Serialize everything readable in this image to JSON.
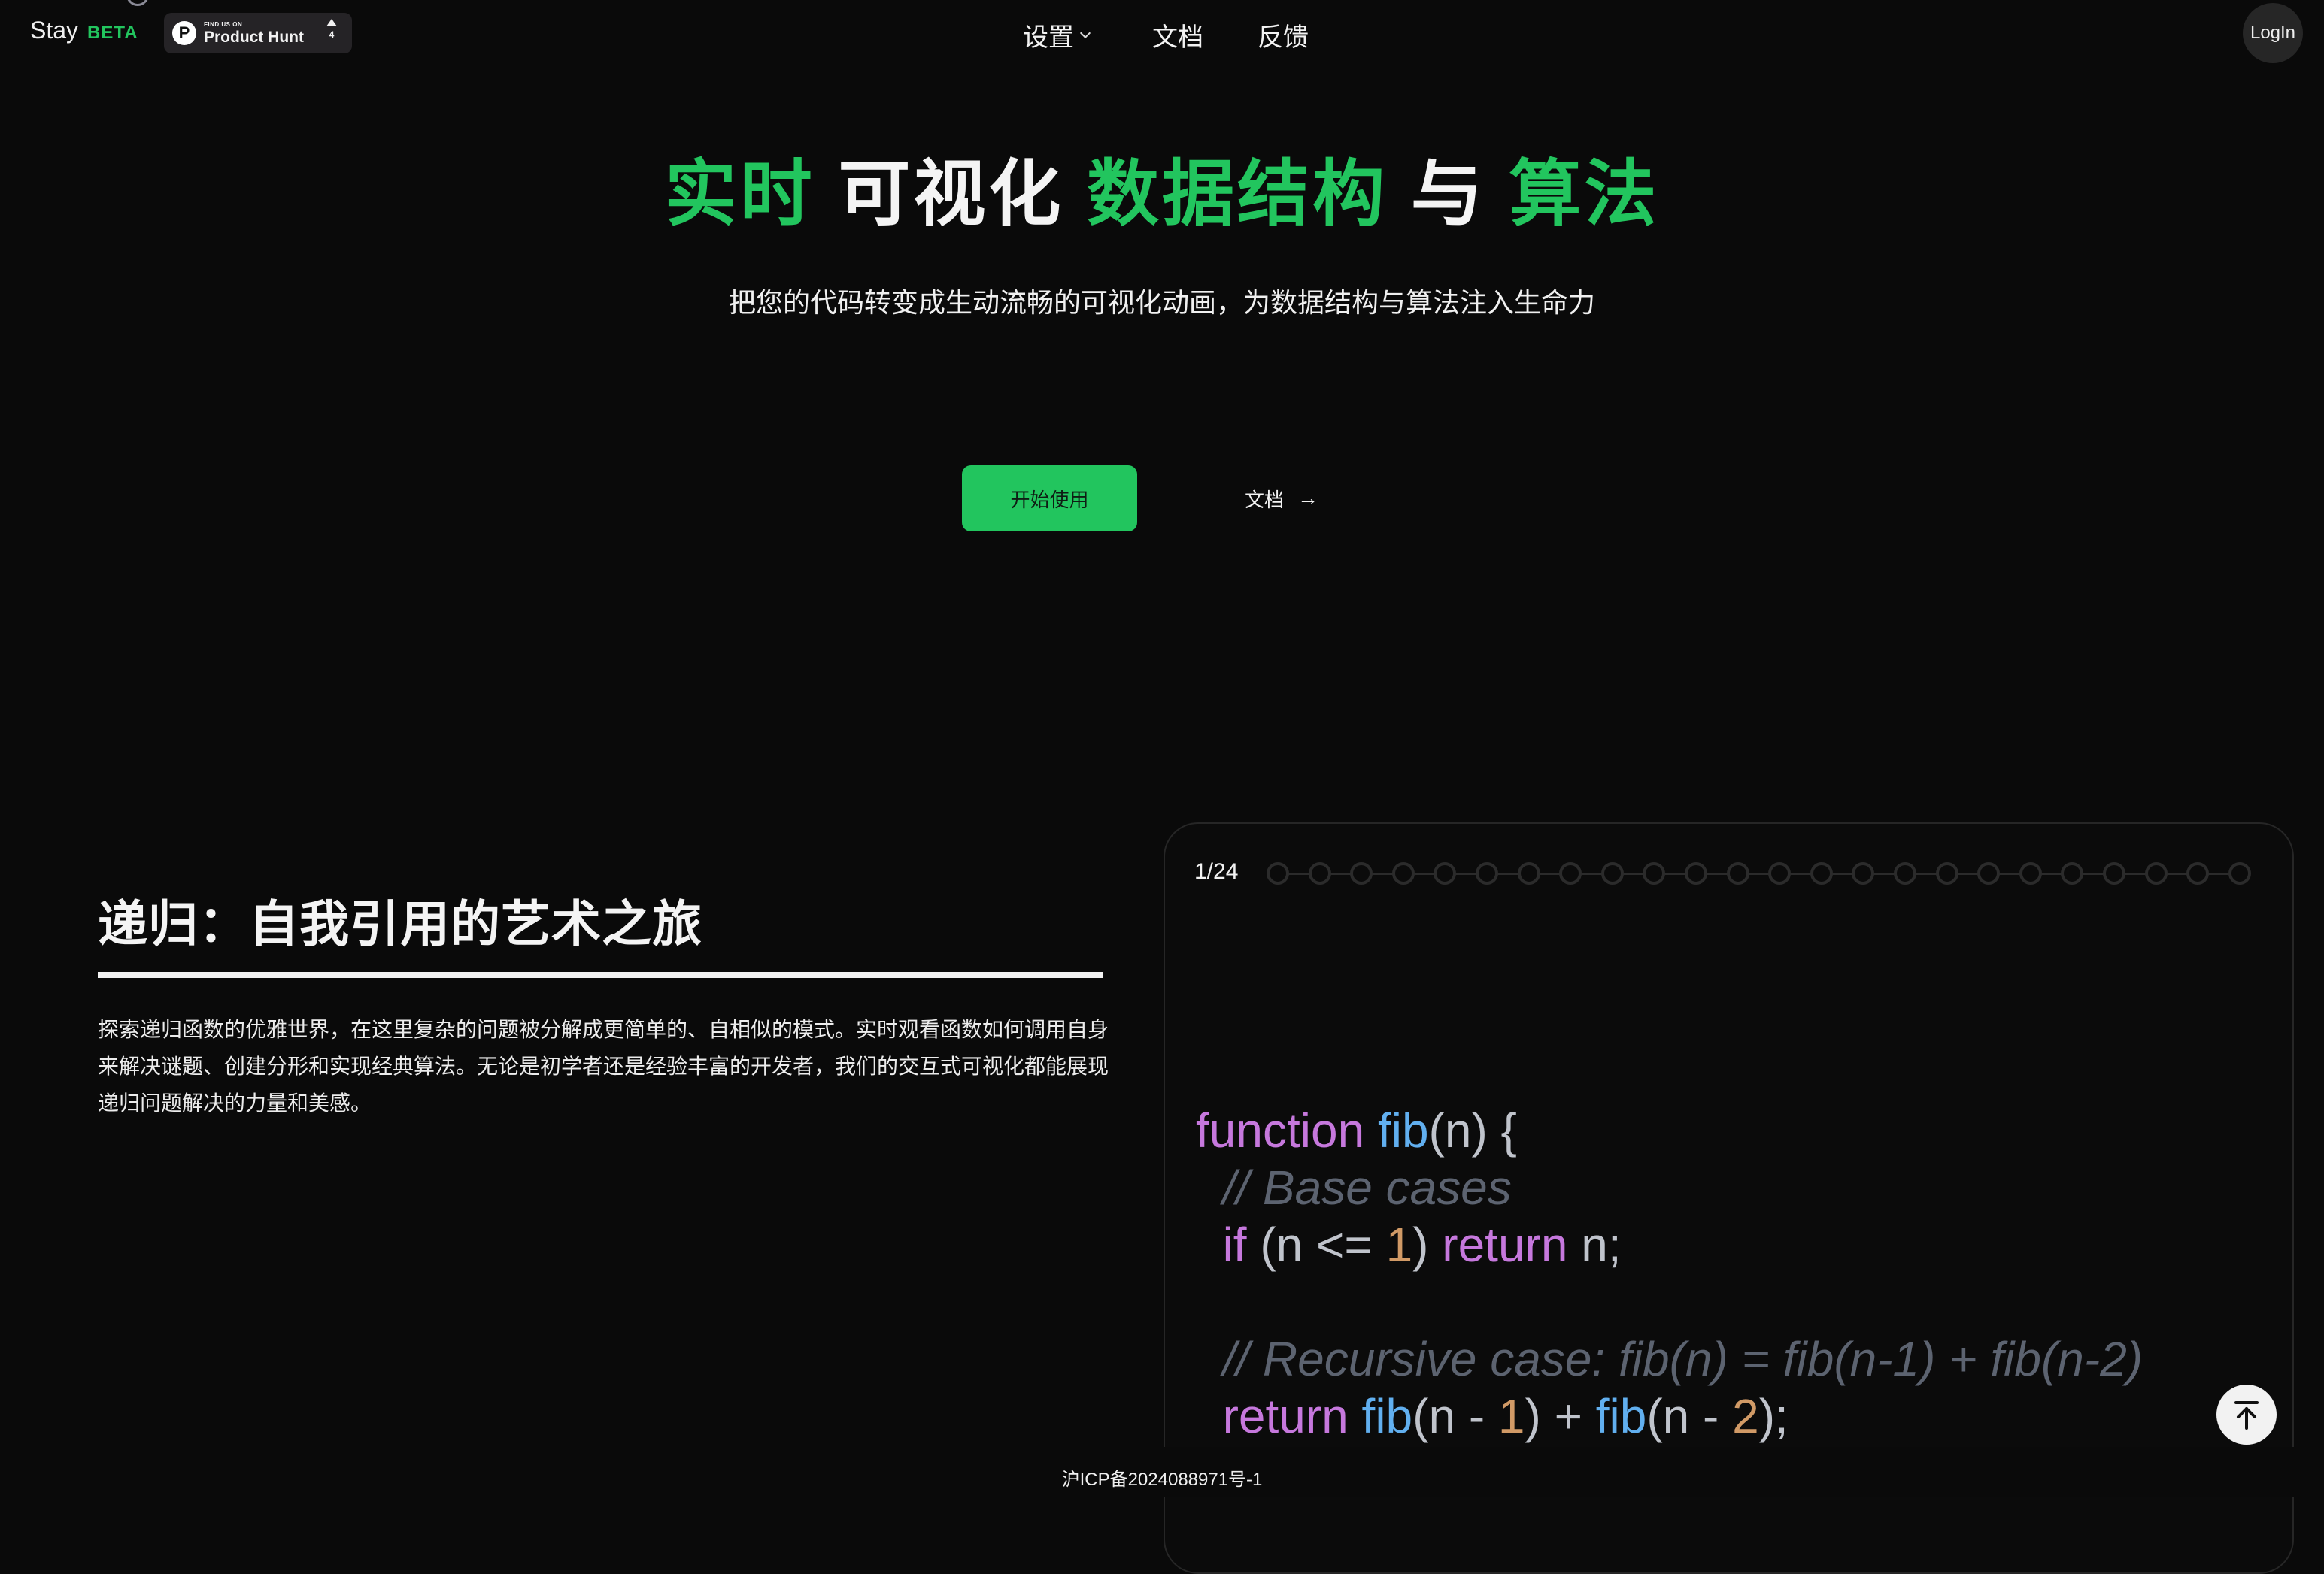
{
  "header": {
    "brand": "Stay",
    "beta": "BETA",
    "product_hunt": {
      "small": "FIND US ON",
      "big": "Product Hunt",
      "logo_letter": "P",
      "votes": "4"
    },
    "nav": [
      {
        "label": "设置",
        "has_dropdown": true
      },
      {
        "label": "文档"
      },
      {
        "label": "反馈"
      }
    ],
    "login": "LogIn"
  },
  "hero": {
    "title_parts": [
      {
        "text": "实时",
        "color": "#22c55e"
      },
      {
        "text": "可视化",
        "color": "#f4f4f4"
      },
      {
        "text": "数据结构",
        "color": "#22c55e"
      },
      {
        "text": "与",
        "color": "#f4f4f4"
      },
      {
        "text": "算法",
        "color": "#22c55e"
      }
    ],
    "subtitle": "把您的代码转变成生动流畅的可视化动画，为数据结构与算法注入生命力",
    "primary_button": "开始使用",
    "docs_link": "文档",
    "docs_arrow": "→"
  },
  "section": {
    "title": "递归：自我引用的艺术之旅",
    "paragraph": "探索递归函数的优雅世界，在这里复杂的问题被分解成更简单的、自相似的模式。实时观看函数如何调用自身来解决谜题、创建分形和实现经典算法。无论是初学者还是经验丰富的开发者，我们的交互式可视化都能展现递归问题解决的力量和美感。"
  },
  "visualizer": {
    "step_label": "1/24",
    "current_step": 1,
    "total_steps": 24,
    "code_lines": [
      [
        {
          "t": "function",
          "c": "kw"
        },
        {
          "t": " ",
          "c": "pl"
        },
        {
          "t": "fib",
          "c": "fn"
        },
        {
          "t": "(n) {",
          "c": "pl"
        }
      ],
      [
        {
          "t": "  // Base cases",
          "c": "cm"
        }
      ],
      [
        {
          "t": "  ",
          "c": "pl"
        },
        {
          "t": "if",
          "c": "kw"
        },
        {
          "t": " (n <= ",
          "c": "pl"
        },
        {
          "t": "1",
          "c": "num"
        },
        {
          "t": ") ",
          "c": "pl"
        },
        {
          "t": "return",
          "c": "kw"
        },
        {
          "t": " n;",
          "c": "pl"
        }
      ],
      [],
      [
        {
          "t": "  // Recursive case: fib(n) = fib(n-1) + fib(n-2)",
          "c": "cm"
        }
      ],
      [
        {
          "t": "  ",
          "c": "pl"
        },
        {
          "t": "return",
          "c": "kw"
        },
        {
          "t": " ",
          "c": "pl"
        },
        {
          "t": "fib",
          "c": "fn"
        },
        {
          "t": "(n - ",
          "c": "pl"
        },
        {
          "t": "1",
          "c": "num"
        },
        {
          "t": ") + ",
          "c": "pl"
        },
        {
          "t": "fib",
          "c": "fn"
        },
        {
          "t": "(n - ",
          "c": "pl"
        },
        {
          "t": "2",
          "c": "num"
        },
        {
          "t": ");",
          "c": "pl"
        }
      ]
    ]
  },
  "footer": {
    "icp": "沪ICP备2024088971号-1"
  },
  "icons": {
    "back_to_top": "arrow-up-to-line-icon",
    "dropdown": "chevron-down-icon",
    "docs_arrow": "arrow-right-icon"
  },
  "colors": {
    "background": "#0a0a0a",
    "accent": "#22c55e",
    "card_border": "#262626"
  }
}
